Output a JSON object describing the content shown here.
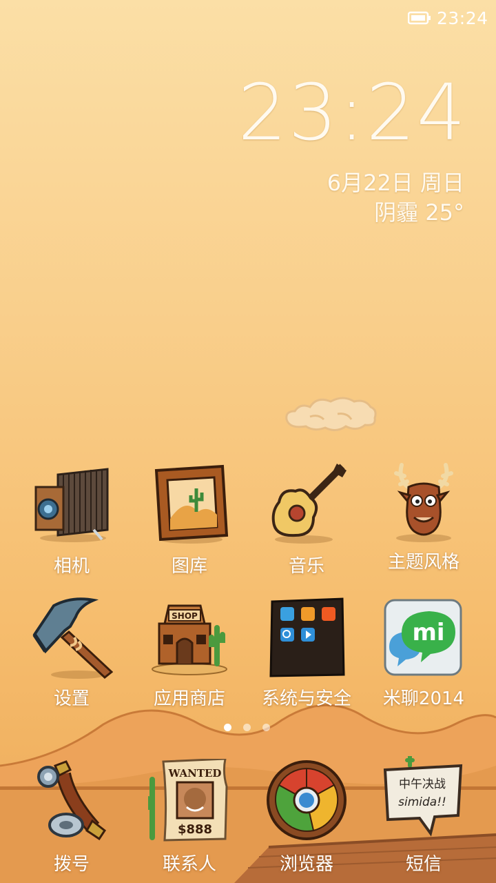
{
  "status_bar": {
    "time": "23:24",
    "battery_icon": "battery-icon"
  },
  "clock_widget": {
    "time": "23:24",
    "date": "6月22日 周日",
    "weather": "阴霾 25°"
  },
  "apps_row1": [
    {
      "label": "相机",
      "icon": "camera-icon"
    },
    {
      "label": "图库",
      "icon": "gallery-icon"
    },
    {
      "label": "音乐",
      "icon": "music-icon"
    },
    {
      "label": "主题风格",
      "icon": "theme-icon"
    }
  ],
  "apps_row2": [
    {
      "label": "设置",
      "icon": "settings-icon"
    },
    {
      "label": "应用商店",
      "icon": "app-store-icon"
    },
    {
      "label": "系统与安全",
      "icon": "system-folder-icon"
    },
    {
      "label": "米聊2014",
      "icon": "miliao-icon"
    }
  ],
  "dock": [
    {
      "label": "拨号",
      "icon": "phone-icon"
    },
    {
      "label": "联系人",
      "icon": "contacts-icon"
    },
    {
      "label": "浏览器",
      "icon": "browser-icon"
    },
    {
      "label": "短信",
      "icon": "messages-icon"
    }
  ],
  "icon_text": {
    "shop_sign": "SHOP",
    "wanted": "WANTED",
    "wanted_price": "$888",
    "mi_logo": "mi",
    "sms_line1": "中午决战",
    "sms_line2": "simida!!"
  },
  "page_indicator": {
    "pages": 3,
    "current": 1
  },
  "colors": {
    "sky_top": "#fbdfa6",
    "sky_bottom": "#eda957",
    "label_text": "#ffffff",
    "miliao_green": "#39b14a"
  }
}
